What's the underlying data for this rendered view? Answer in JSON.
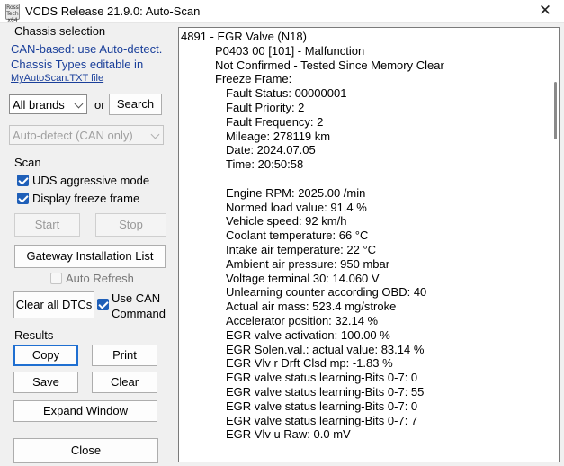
{
  "window": {
    "title": "VCDS Release 21.9.0:  Auto-Scan",
    "icon_name": "vcds-app-icon",
    "icon_text": [
      "Ross",
      "Tech",
      "x64"
    ],
    "close_glyph": "✕"
  },
  "chassis": {
    "heading": "Chassis selection",
    "info_line1": "CAN-based: use Auto-detect.",
    "info_line2": "Chassis Types editable in",
    "file_link": "MyAutoScan.TXT file",
    "brands_select": "All brands",
    "or_label": "or",
    "search_button": "Search",
    "autodetect_select": "Auto-detect (CAN only)"
  },
  "scan": {
    "heading": "Scan",
    "uds_aggressive": {
      "label": "UDS aggressive mode",
      "checked": true
    },
    "display_freeze": {
      "label": "Display freeze frame",
      "checked": true
    },
    "start_button": "Start",
    "stop_button": "Stop",
    "gateway_button": "Gateway Installation List",
    "auto_refresh": {
      "label": "Auto Refresh",
      "checked": false
    },
    "clear_dtcs_button": "Clear all DTCs",
    "use_can": {
      "label_line1": "Use CAN",
      "label_line2": "Command",
      "checked": true
    }
  },
  "results": {
    "heading": "Results",
    "copy_button": "Copy",
    "print_button": "Print",
    "save_button": "Save",
    "clear_button": "Clear",
    "expand_button": "Expand Window",
    "close_button": "Close"
  },
  "output": {
    "lines": [
      {
        "indent": 0,
        "text": "4891 - EGR Valve (N18)"
      },
      {
        "indent": 1,
        "text": "P0403 00 [101] - Malfunction"
      },
      {
        "indent": 1,
        "text": "Not Confirmed - Tested Since Memory Clear"
      },
      {
        "indent": 2,
        "text": "Freeze Frame:"
      },
      {
        "indent": 3,
        "text": "Fault Status: 00000001"
      },
      {
        "indent": 3,
        "text": "Fault Priority: 2"
      },
      {
        "indent": 3,
        "text": "Fault Frequency: 2"
      },
      {
        "indent": 3,
        "text": "Mileage: 278119 km"
      },
      {
        "indent": 3,
        "text": "Date: 2024.07.05"
      },
      {
        "indent": 3,
        "text": "Time: 20:50:58"
      },
      {
        "indent": 3,
        "text": ""
      },
      {
        "indent": 3,
        "text": "Engine RPM: 2025.00 /min"
      },
      {
        "indent": 3,
        "text": "Normed load value: 91.4 %"
      },
      {
        "indent": 3,
        "text": "Vehicle speed: 92 km/h"
      },
      {
        "indent": 3,
        "text": "Coolant temperature: 66 °C"
      },
      {
        "indent": 3,
        "text": "Intake air temperature: 22 °C"
      },
      {
        "indent": 3,
        "text": "Ambient air pressure: 950 mbar"
      },
      {
        "indent": 3,
        "text": "Voltage terminal 30: 14.060 V"
      },
      {
        "indent": 3,
        "text": "Unlearning counter according OBD: 40"
      },
      {
        "indent": 3,
        "text": "Actual air mass: 523.4 mg/stroke"
      },
      {
        "indent": 3,
        "text": "Accelerator position: 32.14 %"
      },
      {
        "indent": 3,
        "text": "EGR valve activation: 100.00 %"
      },
      {
        "indent": 3,
        "text": "EGR Solen.val.: actual value: 83.14 %"
      },
      {
        "indent": 3,
        "text": "EGR Vlv r Drft Clsd mp: -1.83 %"
      },
      {
        "indent": 3,
        "text": "EGR valve status learning-Bits 0-7: 0"
      },
      {
        "indent": 3,
        "text": "EGR valve status learning-Bits 0-7: 55"
      },
      {
        "indent": 3,
        "text": "EGR valve status learning-Bits 0-7: 0"
      },
      {
        "indent": 3,
        "text": "EGR valve status learning-Bits 0-7: 7"
      },
      {
        "indent": 3,
        "text": "EGR Vlv u Raw: 0.0 mV"
      }
    ]
  },
  "colors": {
    "info_text": "#1a3f9a",
    "checkbox_checked": "#1f5fb8",
    "focus_border": "#1f6fd1",
    "window_bg": "#f0f0f0"
  }
}
